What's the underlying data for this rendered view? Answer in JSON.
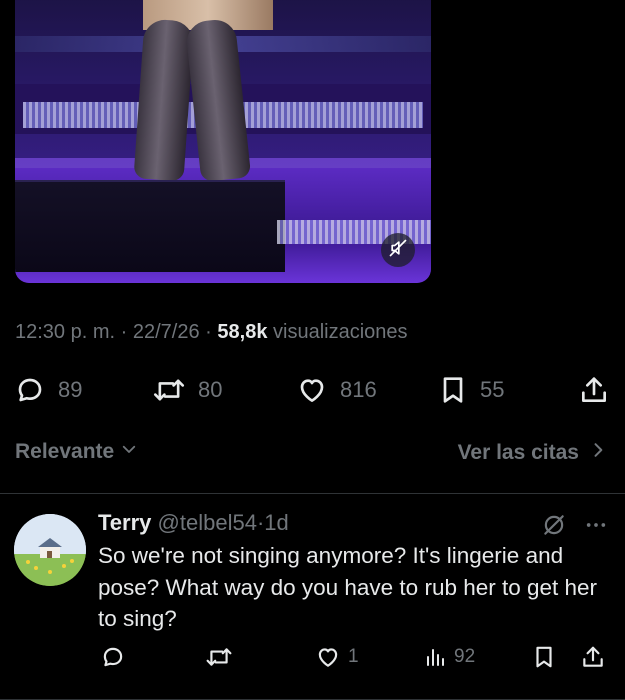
{
  "tweet": {
    "timestamp": "12:30 p. m.",
    "date": "22/7/26",
    "separator": "·",
    "views_count": "58,8k",
    "views_label": "visualizaciones",
    "actions": {
      "replies": "89",
      "reposts": "80",
      "likes": "816",
      "bookmarks": "55"
    }
  },
  "sort": {
    "relevance_label": "Relevante",
    "quotes_label": "Ver las citas"
  },
  "reply": {
    "name": "Terry",
    "handle": "@telbel54",
    "separator": "·",
    "time": "1d",
    "text": "So we're not singing anymore? It's lingerie and pose? What way do you have to rub her to get her to sing?",
    "actions": {
      "likes": "1",
      "views": "92"
    }
  },
  "colors": {
    "background": "#000000",
    "text_primary": "#e7e9ea",
    "text_secondary": "#71767b",
    "divider": "#2f3336"
  },
  "icons": {
    "video_mute": "speaker-muted-icon",
    "reply": "speech-bubble-icon",
    "repost": "repost-arrows-icon",
    "like": "heart-icon",
    "bookmark": "bookmark-icon",
    "share": "share-upload-icon",
    "sort_dropdown": "chevron-down-icon",
    "quotes_link": "chevron-right-icon",
    "grok": "grok-slash-icon",
    "more": "more-dots-icon",
    "views": "bar-chart-icon"
  }
}
